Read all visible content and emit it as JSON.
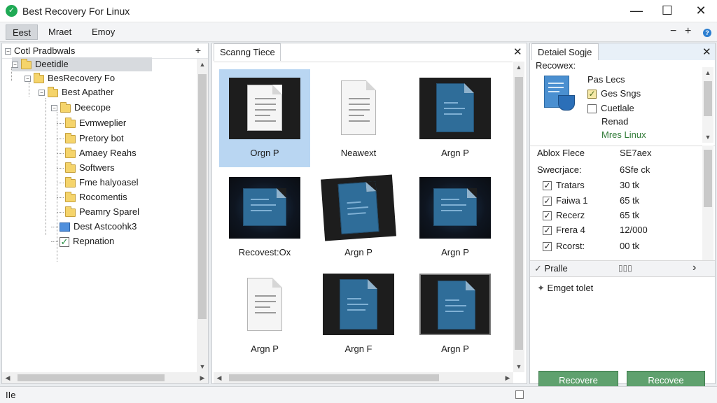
{
  "window": {
    "title": "Best Recovery For Linux",
    "minimize_glyph": "—",
    "maximize_glyph": "☐",
    "close_glyph": "✕"
  },
  "menu": {
    "items": [
      "Eest",
      "Mraet",
      "Emoy"
    ],
    "minus_glyph": "−",
    "plus_glyph": "+",
    "help_glyph": "?"
  },
  "tree": {
    "header": "Cotl Pradbwals",
    "header_action": "+",
    "items": [
      {
        "label": "Deetidle"
      },
      {
        "label": "BesRecovery Fo"
      },
      {
        "label": "Best Apather"
      },
      {
        "label": "Deecope"
      },
      {
        "label": "Evmweplier"
      },
      {
        "label": "Pretory bot"
      },
      {
        "label": "Amaey Reahs"
      },
      {
        "label": "Softwers"
      },
      {
        "label": "Fme halyoasel"
      },
      {
        "label": "Rocomentis"
      },
      {
        "label": "Peamry Sparel"
      },
      {
        "label": "Dest Astcoohk3"
      },
      {
        "label": "Repnation"
      }
    ]
  },
  "center": {
    "tab_label": "Scanng Tiece",
    "close_glyph": "✕",
    "files": [
      {
        "label": "Orgn P"
      },
      {
        "label": "Neawext"
      },
      {
        "label": "Argn P"
      },
      {
        "label": "Recovest:Ox"
      },
      {
        "label": "Argn P"
      },
      {
        "label": "Argn P"
      },
      {
        "label": "Argn P"
      },
      {
        "label": "Argn F"
      },
      {
        "label": "Argn P"
      }
    ]
  },
  "details": {
    "tab_label": "Detaiel Sogje",
    "close_glyph": "✕",
    "subtitle": "Recowex:",
    "preview_title": "Pas Lecs",
    "options": [
      {
        "label": "Ges Sngs",
        "check": "✓"
      },
      {
        "label": "Cuetlale",
        "check": ""
      }
    ],
    "extra1": "Renad",
    "extra2": "Mres Linux",
    "info_rows": [
      {
        "name": "Ablox Flece",
        "value": "SE7aex"
      },
      {
        "name": "Swecrjace:",
        "value": "6Sfe ck"
      }
    ],
    "file_rows": [
      {
        "name": "Tratars",
        "value": "30 tk"
      },
      {
        "name": "Faiwa 1",
        "value": "65 tk"
      },
      {
        "name": "Recerz",
        "value": "65 tk"
      },
      {
        "name": "Frera 4",
        "value": "12/000"
      },
      {
        "name": "Rcorst:",
        "value": "00 tk"
      }
    ],
    "check_glyph": "✓",
    "bar_label": "Pralle",
    "bar_icons": "▯▯▯",
    "bar_arrow": "›",
    "expand_label": "Emget tolet",
    "expand_glyph": "✦",
    "buttons": [
      "Recovere",
      "Recovee"
    ]
  },
  "status": {
    "text": "IIe"
  }
}
